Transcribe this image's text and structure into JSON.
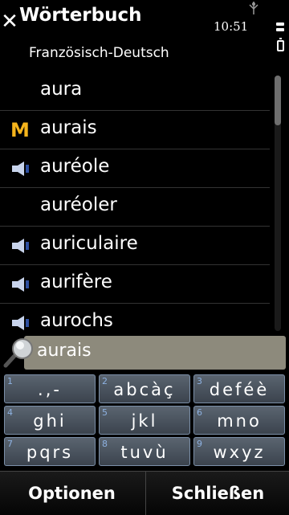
{
  "header": {
    "title": "Wörterbuch",
    "subtitle": "Französisch-Deutsch",
    "time": "10:51"
  },
  "list": {
    "items": [
      {
        "word": "aura",
        "icon": null
      },
      {
        "word": "aurais",
        "icon": "m-icon"
      },
      {
        "word": "auréole",
        "icon": "speaker-icon"
      },
      {
        "word": "auréoler",
        "icon": null
      },
      {
        "word": "auriculaire",
        "icon": "speaker-icon"
      },
      {
        "word": "aurifère",
        "icon": "speaker-icon"
      },
      {
        "word": "aurochs",
        "icon": "speaker-icon"
      }
    ],
    "m_label": "M"
  },
  "search": {
    "value": "aurais"
  },
  "keypad": {
    "keys": [
      {
        "num": "1",
        "chars": ".,-"
      },
      {
        "num": "2",
        "chars": "abcàç"
      },
      {
        "num": "3",
        "chars": "deféè"
      },
      {
        "num": "4",
        "chars": "ghi"
      },
      {
        "num": "5",
        "chars": "jkl"
      },
      {
        "num": "6",
        "chars": "mno"
      },
      {
        "num": "7",
        "chars": "pqrs"
      },
      {
        "num": "8",
        "chars": "tuvù"
      },
      {
        "num": "9",
        "chars": "wxyz"
      }
    ]
  },
  "softkeys": {
    "left": "Optionen",
    "right": "Schließen"
  },
  "colors": {
    "m_icon": "#f5b41c",
    "speaker": "#c8d4ec",
    "search_bg": "#8d8a7c",
    "key_border": "#7b8fa8",
    "key_number": "#8db1e0"
  }
}
